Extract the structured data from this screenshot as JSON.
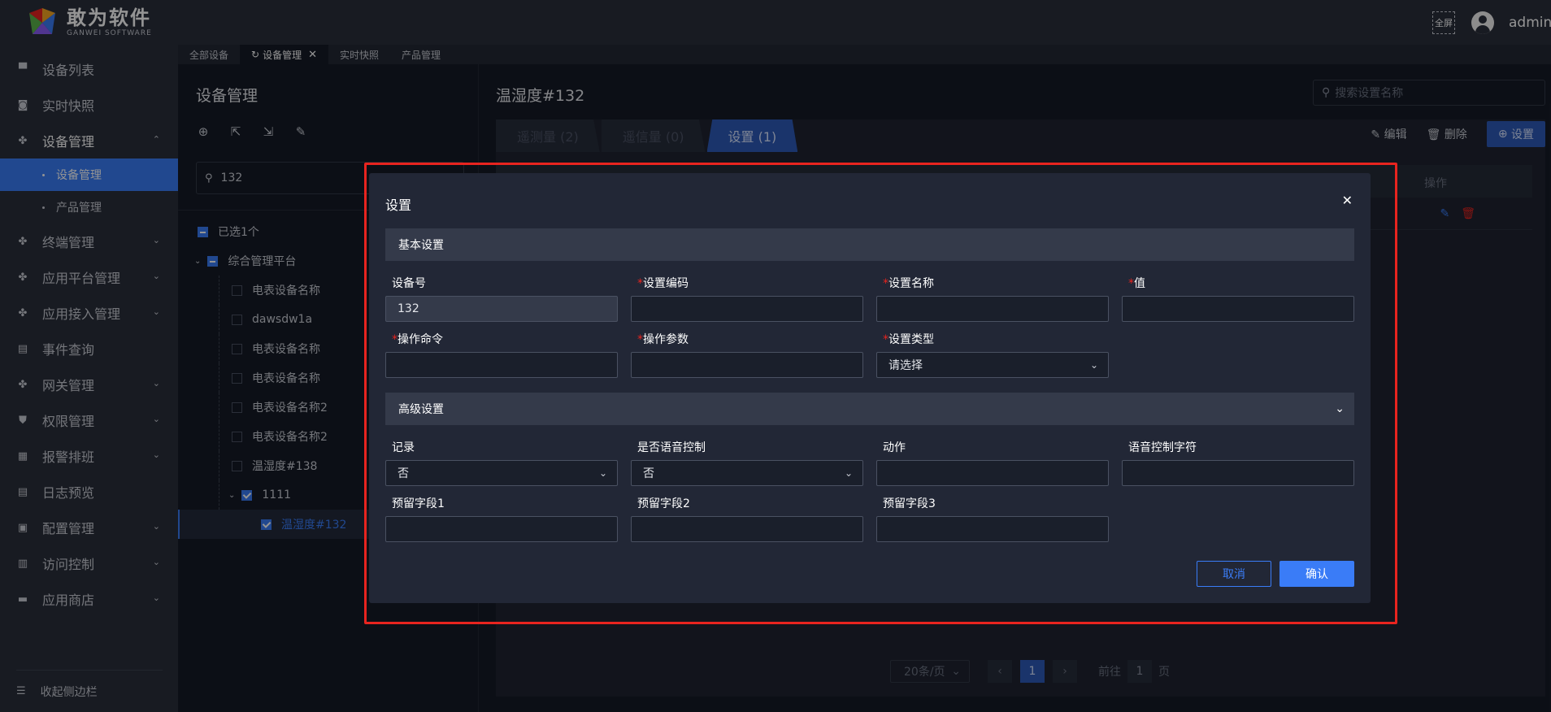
{
  "header": {
    "logo_cn": "敢为软件",
    "logo_en": "GANWEI SOFTWARE",
    "fullscreen_label": "全屏",
    "username": "admin",
    "logo_colors": [
      "#e8241f",
      "#f5a623",
      "#5ab44b",
      "#3a7cf7"
    ]
  },
  "sidebar": {
    "items": [
      {
        "label": "设备列表",
        "icon": "monitor-icon"
      },
      {
        "label": "实时快照",
        "icon": "camera-icon"
      },
      {
        "label": "设备管理",
        "icon": "grid-icon"
      },
      {
        "label": "终端管理",
        "icon": "grid-icon"
      },
      {
        "label": "应用平台管理",
        "icon": "grid-icon"
      },
      {
        "label": "应用接入管理",
        "icon": "grid-icon"
      },
      {
        "label": "事件查询",
        "icon": "document-search-icon"
      },
      {
        "label": "网关管理",
        "icon": "grid-icon"
      },
      {
        "label": "权限管理",
        "icon": "shield-icon"
      },
      {
        "label": "报警排班",
        "icon": "calendar-icon"
      },
      {
        "label": "日志预览",
        "icon": "log-icon"
      },
      {
        "label": "配置管理",
        "icon": "book-icon"
      },
      {
        "label": "访问控制",
        "icon": "access-icon"
      },
      {
        "label": "应用商店",
        "icon": "store-icon"
      }
    ],
    "sub_items": [
      "设备管理",
      "产品管理"
    ],
    "collapse_label": "收起侧边栏"
  },
  "tabs": [
    {
      "label": "全部设备"
    },
    {
      "label": "设备管理"
    },
    {
      "label": "实时快照"
    },
    {
      "label": "产品管理"
    }
  ],
  "left_panel": {
    "title": "设备管理",
    "search_value": "132",
    "selected_count": "已选1个",
    "tree": [
      {
        "label": "综合管理平台"
      },
      {
        "label": "电表设备名称"
      },
      {
        "label": "dawsdw1a"
      },
      {
        "label": "电表设备名称"
      },
      {
        "label": "电表设备名称"
      },
      {
        "label": "电表设备名称2"
      },
      {
        "label": "电表设备名称2"
      },
      {
        "label": "温湿度#138"
      },
      {
        "label": "1111"
      },
      {
        "label": "温湿度#132"
      }
    ]
  },
  "right_panel": {
    "title": "温湿度#132",
    "search_placeholder": "搜索设置名称",
    "subtabs": [
      "遥测量 (2)",
      "遥信量 (0)",
      "设置 (1)"
    ],
    "edit_label": "编辑",
    "delete_label": "删除",
    "set_label": "设置",
    "table_header_op": "操作",
    "pager": {
      "page_size": "20条/页",
      "current_page": "1",
      "goto_label": "前往",
      "goto_value": "1",
      "page_unit": "页"
    }
  },
  "dialog": {
    "title": "设置",
    "basic_section": "基本设置",
    "advanced_section": "高级设置",
    "fields": {
      "device_no": {
        "label": "设备号",
        "value": "132"
      },
      "set_code": {
        "label": "设置编码",
        "value": ""
      },
      "set_name": {
        "label": "设置名称",
        "value": ""
      },
      "value": {
        "label": "值",
        "value": ""
      },
      "op_cmd": {
        "label": "操作命令",
        "value": ""
      },
      "op_param": {
        "label": "操作参数",
        "value": ""
      },
      "set_type": {
        "label": "设置类型",
        "placeholder": "请选择"
      },
      "record": {
        "label": "记录",
        "value": "否"
      },
      "voice_ctrl": {
        "label": "是否语音控制",
        "value": "否"
      },
      "action": {
        "label": "动作",
        "value": ""
      },
      "voice_str": {
        "label": "语音控制字符",
        "value": ""
      },
      "reserve1": {
        "label": "预留字段1",
        "value": ""
      },
      "reserve2": {
        "label": "预留字段2",
        "value": ""
      },
      "reserve3": {
        "label": "预留字段3",
        "value": ""
      }
    },
    "cancel_label": "取消",
    "ok_label": "确认"
  }
}
